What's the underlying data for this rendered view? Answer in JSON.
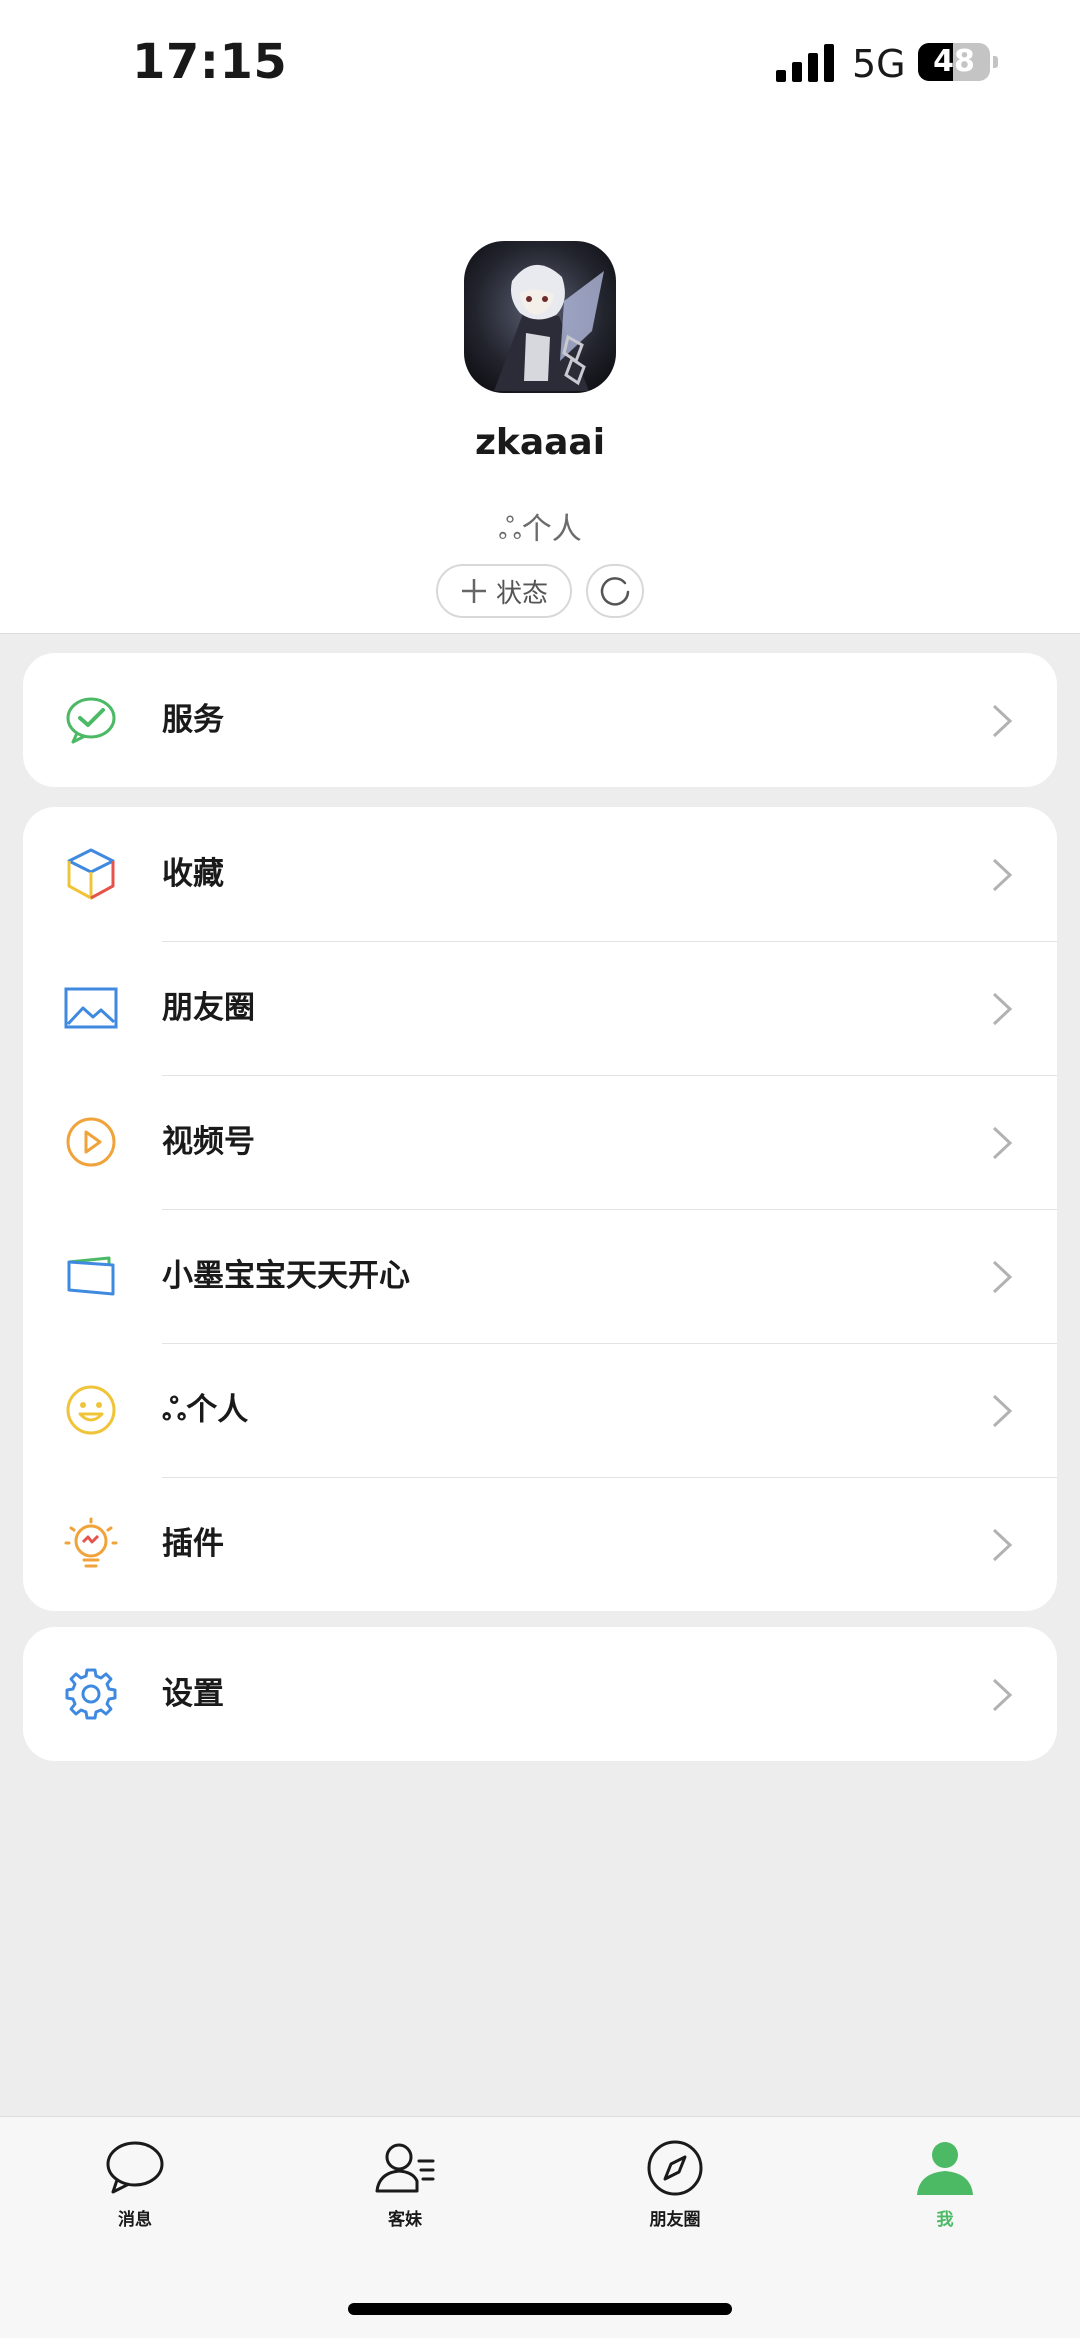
{
  "status_bar": {
    "time": "17:15",
    "network": "5G",
    "battery": "48",
    "battery_level": 0.48
  },
  "profile": {
    "nickname": "zkaaai",
    "signature": "ஃ个人",
    "status_button": "状态"
  },
  "menu": {
    "service": "服务",
    "favorites": "收藏",
    "moments": "朋友圈",
    "channels": "视频号",
    "cards": "小墨宝宝天天开心",
    "sticker": "ஃ个人",
    "plugins": "插件",
    "settings": "设置"
  },
  "tabs": {
    "messages": "消息",
    "contacts": "客妹",
    "discover": "朋友圈",
    "me": "我"
  },
  "colors": {
    "accent": "#4cba65",
    "background": "#ededed"
  }
}
